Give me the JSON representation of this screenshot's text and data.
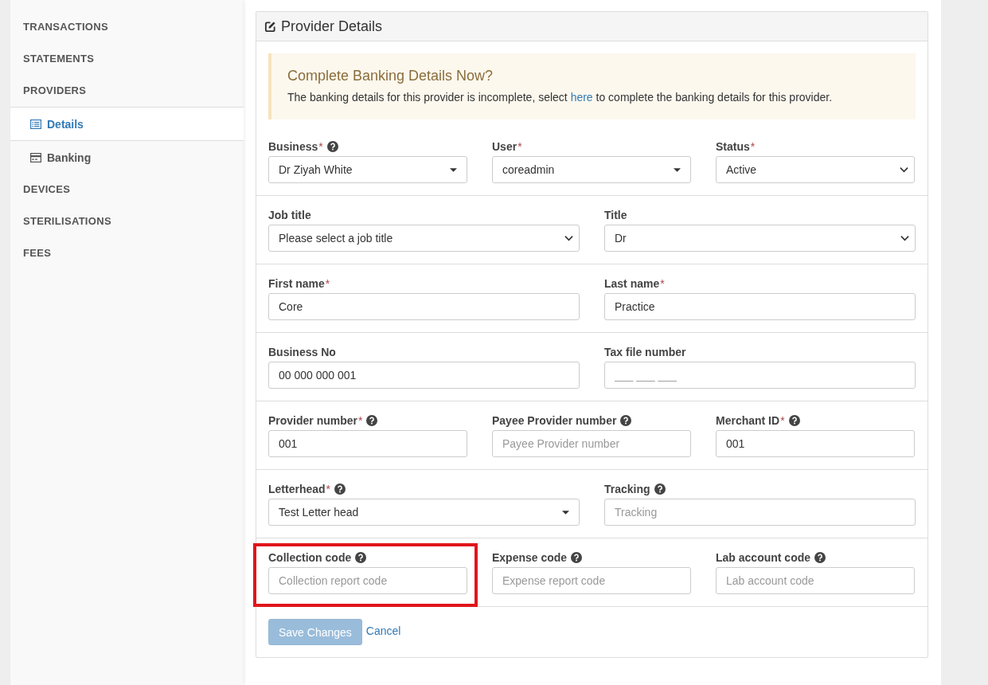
{
  "sidebar": {
    "items": [
      {
        "label": "TRANSACTIONS",
        "kind": "section",
        "selected": false
      },
      {
        "label": "STATEMENTS",
        "kind": "section",
        "selected": false
      },
      {
        "label": "PROVIDERS",
        "kind": "section",
        "selected": false
      },
      {
        "label": "Details",
        "kind": "sub",
        "selected": true
      },
      {
        "label": "Banking",
        "kind": "sub",
        "selected": false
      },
      {
        "label": "DEVICES",
        "kind": "section",
        "selected": false
      },
      {
        "label": "STERILISATIONS",
        "kind": "section",
        "selected": false
      },
      {
        "label": "FEES",
        "kind": "section",
        "selected": false
      }
    ]
  },
  "panel": {
    "title": "Provider Details",
    "alert": {
      "heading": "Complete Banking Details Now?",
      "text_before": "The banking details for this provider is incomplete, select",
      "link": "here",
      "text_after": "to complete the banking details for this provider."
    },
    "rows": [
      {
        "fields": [
          {
            "label": "Business",
            "required_mark": "*",
            "help": true,
            "kind": "dropdown",
            "value": "Dr Ziyah White"
          },
          {
            "label": "User",
            "required_mark": "*",
            "help": false,
            "kind": "dropdown",
            "value": "coreadmin"
          },
          {
            "label": "Status",
            "required_mark": "*",
            "help": false,
            "kind": "select",
            "value": "Active"
          }
        ]
      },
      {
        "fields": [
          {
            "label": "Job title",
            "help": false,
            "kind": "select",
            "value": "Please select a job title"
          },
          {
            "label": "Title",
            "help": false,
            "kind": "select",
            "value": "Dr"
          }
        ]
      },
      {
        "fields": [
          {
            "label": "First name",
            "required_mark": "*",
            "help": false,
            "kind": "input",
            "value": "Core"
          },
          {
            "label": "Last name",
            "required_mark": "*",
            "help": false,
            "kind": "input",
            "value": "Practice"
          }
        ]
      },
      {
        "fields": [
          {
            "label": "Business No",
            "help": false,
            "kind": "input",
            "value": "00 000 000 001"
          },
          {
            "label": "Tax file number",
            "help": false,
            "kind": "input",
            "placeholder": "___ ___ ___"
          }
        ]
      },
      {
        "fields": [
          {
            "label": "Provider number",
            "required_mark": "*",
            "help": true,
            "kind": "input",
            "value": "001"
          },
          {
            "label": "Payee Provider number",
            "help": true,
            "kind": "input",
            "placeholder": "Payee Provider number"
          },
          {
            "label": "Merchant ID",
            "required_mark": "*",
            "help": true,
            "kind": "input",
            "value": "001"
          }
        ]
      },
      {
        "fields": [
          {
            "label": "Letterhead",
            "required_mark": "*",
            "help": true,
            "kind": "dropdown",
            "value": "Test Letter head"
          },
          {
            "label": "Tracking",
            "help": true,
            "kind": "input",
            "placeholder": "Tracking"
          }
        ]
      },
      {
        "fields": [
          {
            "label": "Collection code",
            "help": true,
            "kind": "input",
            "placeholder": "Collection report code",
            "highlighted": true
          },
          {
            "label": "Expense code",
            "help": true,
            "kind": "input",
            "placeholder": "Expense report code",
            "highlighted": false
          },
          {
            "label": "Lab account code",
            "help": true,
            "kind": "input",
            "placeholder": "Lab account code",
            "highlighted": false
          }
        ]
      }
    ],
    "save_button": {
      "label": "Save Changes",
      "disabled": true
    },
    "cancel_link": "Cancel"
  }
}
